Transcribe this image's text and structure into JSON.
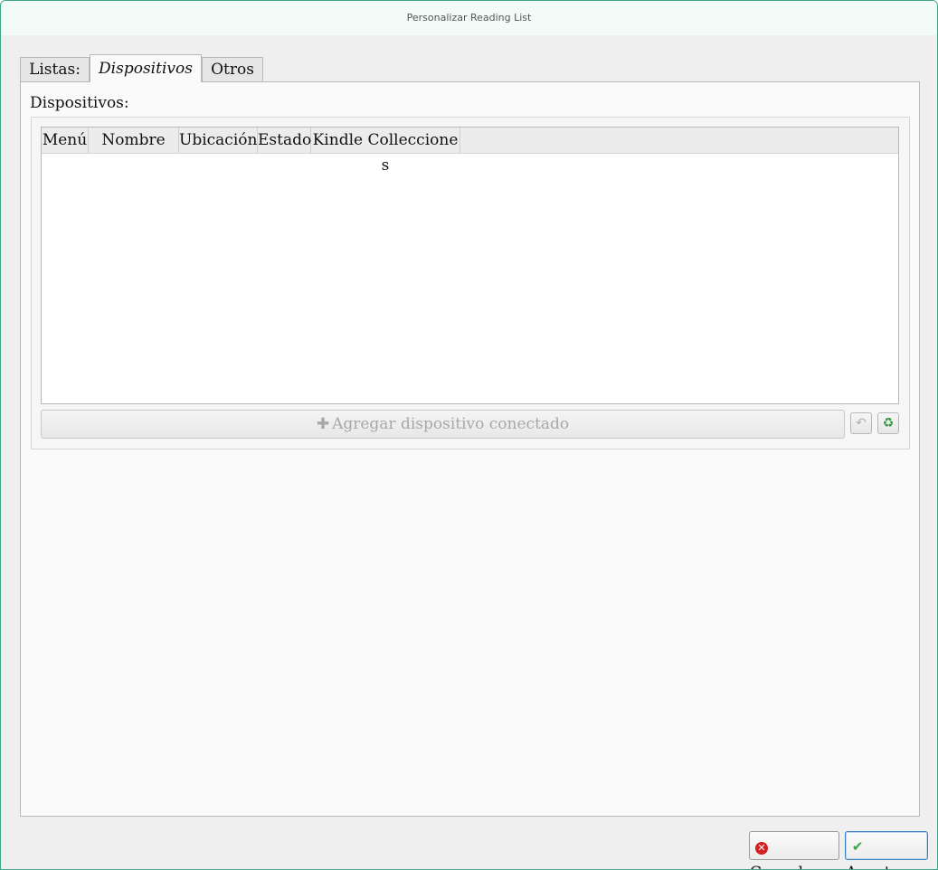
{
  "window": {
    "title": "Personalizar Reading List"
  },
  "tabs": [
    {
      "label": "Listas:",
      "active": false
    },
    {
      "label": "Dispositivos",
      "active": true
    },
    {
      "label": "Otros",
      "active": false
    }
  ],
  "devices": {
    "section_label": "Dispositivos:",
    "columns": [
      "Menú",
      "Nombre",
      "Ubicación",
      "Estado",
      "Kindle Colleccione​s"
    ],
    "rows": [],
    "add_button": {
      "label": "Agregar dispositivo conectado",
      "icon": "plus-icon",
      "enabled": false
    },
    "undo_icon": "undo-icon",
    "recycle_icon": "recycle-icon"
  },
  "buttons": {
    "cancel": {
      "first_letter": "C",
      "rest": "ancelar",
      "icon": "cancel-icon",
      "icon_color": "#d42020"
    },
    "accept": {
      "first_letter": "A",
      "rest": "ceptar",
      "icon": "check-icon",
      "icon_color": "#3aa54a"
    }
  }
}
